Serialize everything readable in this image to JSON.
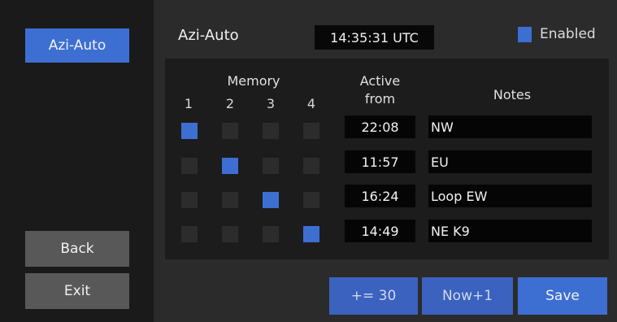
{
  "sidebar": {
    "mode_button": "Azi-Auto",
    "back_button": "Back",
    "exit_button": "Exit"
  },
  "header": {
    "title": "Azi-Auto",
    "clock": "14:35:31 UTC",
    "enabled_label": "Enabled",
    "enabled": true
  },
  "table": {
    "memory_header": "Memory",
    "memory_numbers": [
      "1",
      "2",
      "3",
      "4"
    ],
    "active_from_header_line1": "Active",
    "active_from_header_line2": "from",
    "notes_header": "Notes",
    "rows": [
      {
        "selected_memory": 1,
        "active_from": "22:08",
        "note": "NW"
      },
      {
        "selected_memory": 2,
        "active_from": "11:57",
        "note": "EU"
      },
      {
        "selected_memory": 3,
        "active_from": "16:24",
        "note": "Loop EW"
      },
      {
        "selected_memory": 4,
        "active_from": "14:49",
        "note": "NE K9"
      }
    ]
  },
  "footer": {
    "increment_button": "+= 30",
    "now_plus_button": "Now+1",
    "save_button": "Save"
  },
  "colors": {
    "accent": "#3d6fd2",
    "button_gray": "#585858"
  }
}
